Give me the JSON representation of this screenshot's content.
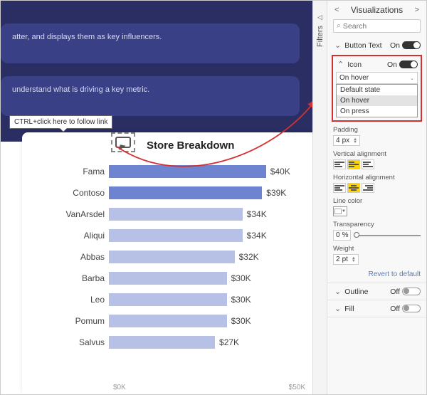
{
  "cards": {
    "c1": "atter, and displays them as key influencers.",
    "c2": " understand what is driving a key metric."
  },
  "tooltip": "CTRL+click here to follow link",
  "chart_data": {
    "type": "bar",
    "title": "Store Breakdown",
    "categories": [
      "Fama",
      "Contoso",
      "VanArsdel",
      "Aliqui",
      "Abbas",
      "Barba",
      "Leo",
      "Pomum",
      "Salvus"
    ],
    "values": [
      40,
      39,
      34,
      34,
      32,
      30,
      30,
      30,
      27
    ],
    "labels": [
      "$40K",
      "$39K",
      "$34K",
      "$34K",
      "$32K",
      "$30K",
      "$30K",
      "$30K",
      "$27K"
    ],
    "colors": [
      "#6f84d1",
      "#6f84d1",
      "#b7c1e6",
      "#b7c1e6",
      "#b7c1e6",
      "#b7c1e6",
      "#b7c1e6",
      "#b7c1e6",
      "#b7c1e6"
    ],
    "xlim": [
      0,
      50
    ],
    "xticks": [
      "$0K",
      "$50K"
    ]
  },
  "filters": {
    "label": "Filters"
  },
  "pane": {
    "title": "Visualizations",
    "search_placeholder": "Search",
    "button_text": {
      "label": "Button Text",
      "state": "On"
    },
    "icon": {
      "label": "Icon",
      "state": "On"
    },
    "dropdown": {
      "selected": "On hover",
      "options": [
        "Default state",
        "On hover",
        "On press"
      ]
    },
    "padding": {
      "label": "Padding",
      "value": "4",
      "unit": "px"
    },
    "valign": {
      "label": "Vertical alignment"
    },
    "halign": {
      "label": "Horizontal alignment"
    },
    "line_color": {
      "label": "Line color"
    },
    "transparency": {
      "label": "Transparency",
      "value": "0",
      "unit": "%"
    },
    "weight": {
      "label": "Weight",
      "value": "2",
      "unit": "pt"
    },
    "revert": "Revert to default",
    "outline": {
      "label": "Outline",
      "state": "Off"
    },
    "fill": {
      "label": "Fill",
      "state": "Off"
    }
  }
}
